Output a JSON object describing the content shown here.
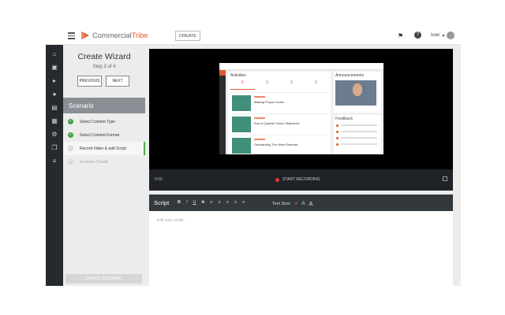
{
  "topbar": {
    "logo_main": "Commercial",
    "logo_accent": "Tribe",
    "create_label": "CREATE",
    "user_name": "Ivan"
  },
  "wizard": {
    "title": "Create Wizard",
    "step_text": "Step 3 of 4",
    "previous_label": "PREVIOUS",
    "next_label": "NEXT",
    "section_title": "Scenario",
    "steps": [
      {
        "label": "Select Content Type",
        "state": "done"
      },
      {
        "label": "Select Content Format",
        "state": "done"
      },
      {
        "label": "Record Video & add Script",
        "state": "active"
      },
      {
        "label": "Scenario Details",
        "state": "pending"
      }
    ],
    "create_scenario_label": "CREATE SCENARIO"
  },
  "video": {
    "time": "0:00",
    "record_label": "START RECORDING",
    "preview": {
      "activities_title": "Activities",
      "stats": [
        "6",
        "3",
        "2",
        "2"
      ],
      "cards": [
        "Making Proper Goals",
        "End of Quarter Close Objectives",
        "Onboarding The Work Exercise"
      ],
      "announcements_title": "Announcements",
      "feedback_title": "Feedback"
    }
  },
  "script": {
    "label": "Script",
    "tools": [
      "B",
      "I",
      "U",
      "S",
      "≡",
      "≡",
      "≡",
      "≡",
      "≡"
    ],
    "text_size_label": "Text Size:",
    "text_size_options": [
      "A",
      "A",
      "A"
    ],
    "placeholder": "Edit your script..."
  },
  "colors": {
    "brand": "#e3582a",
    "done": "#43a047",
    "iconbar": "#262a2f"
  }
}
